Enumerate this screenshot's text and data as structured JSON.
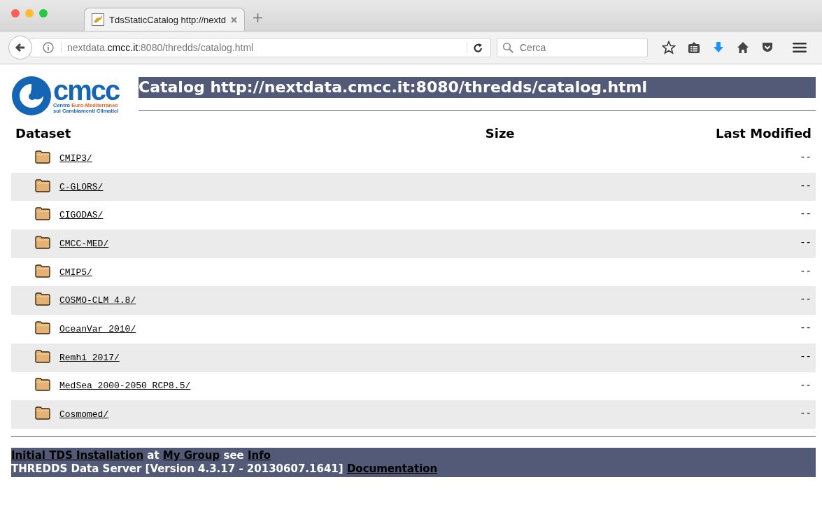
{
  "browser": {
    "tab_title": "TdsStaticCatalog http://nextd",
    "address": {
      "prefix": "nextdata.",
      "domain": "cmcc.it",
      "suffix": ":8080/thredds/catalog.html"
    },
    "search": {
      "placeholder": "Cerca"
    }
  },
  "logo": {
    "word": "cmcc",
    "line1_a": "Centro",
    "line1_b": "Euro-Mediterraneo",
    "line2": "sui Cambiamenti Climatici"
  },
  "heading": "Catalog http://nextdata.cmcc.it:8080/thredds/catalog.html",
  "table": {
    "columns": [
      "Dataset",
      "Size",
      "Last Modified"
    ],
    "rows": [
      {
        "name": "CMIP3/",
        "modified": "--"
      },
      {
        "name": "C-GLORS/",
        "modified": "--"
      },
      {
        "name": "CIGODAS/",
        "modified": "--"
      },
      {
        "name": "CMCC-MED/",
        "modified": "--"
      },
      {
        "name": "CMIP5/",
        "modified": "--"
      },
      {
        "name": "COSMO-CLM_4.8/",
        "modified": "--"
      },
      {
        "name": "OceanVar_2010/",
        "modified": "--"
      },
      {
        "name": "Remhi_2017/",
        "modified": "--"
      },
      {
        "name": "MedSea_2000-2050_RCP8.5/",
        "modified": "--"
      },
      {
        "name": "Cosmomed/",
        "modified": "--"
      }
    ]
  },
  "footer": {
    "lines": [
      [
        {
          "kind": "link",
          "text": "Initial TDS Installation"
        },
        {
          "kind": "text",
          "text": "at"
        },
        {
          "kind": "link",
          "text": "My Group"
        },
        {
          "kind": "text",
          "text": "see"
        },
        {
          "kind": "link",
          "text": "Info"
        }
      ],
      [
        {
          "kind": "text",
          "text": "THREDDS Data Server [Version 4.3.17 - 20130607.1641]"
        },
        {
          "kind": "link",
          "text": "Documentation"
        }
      ]
    ]
  }
}
